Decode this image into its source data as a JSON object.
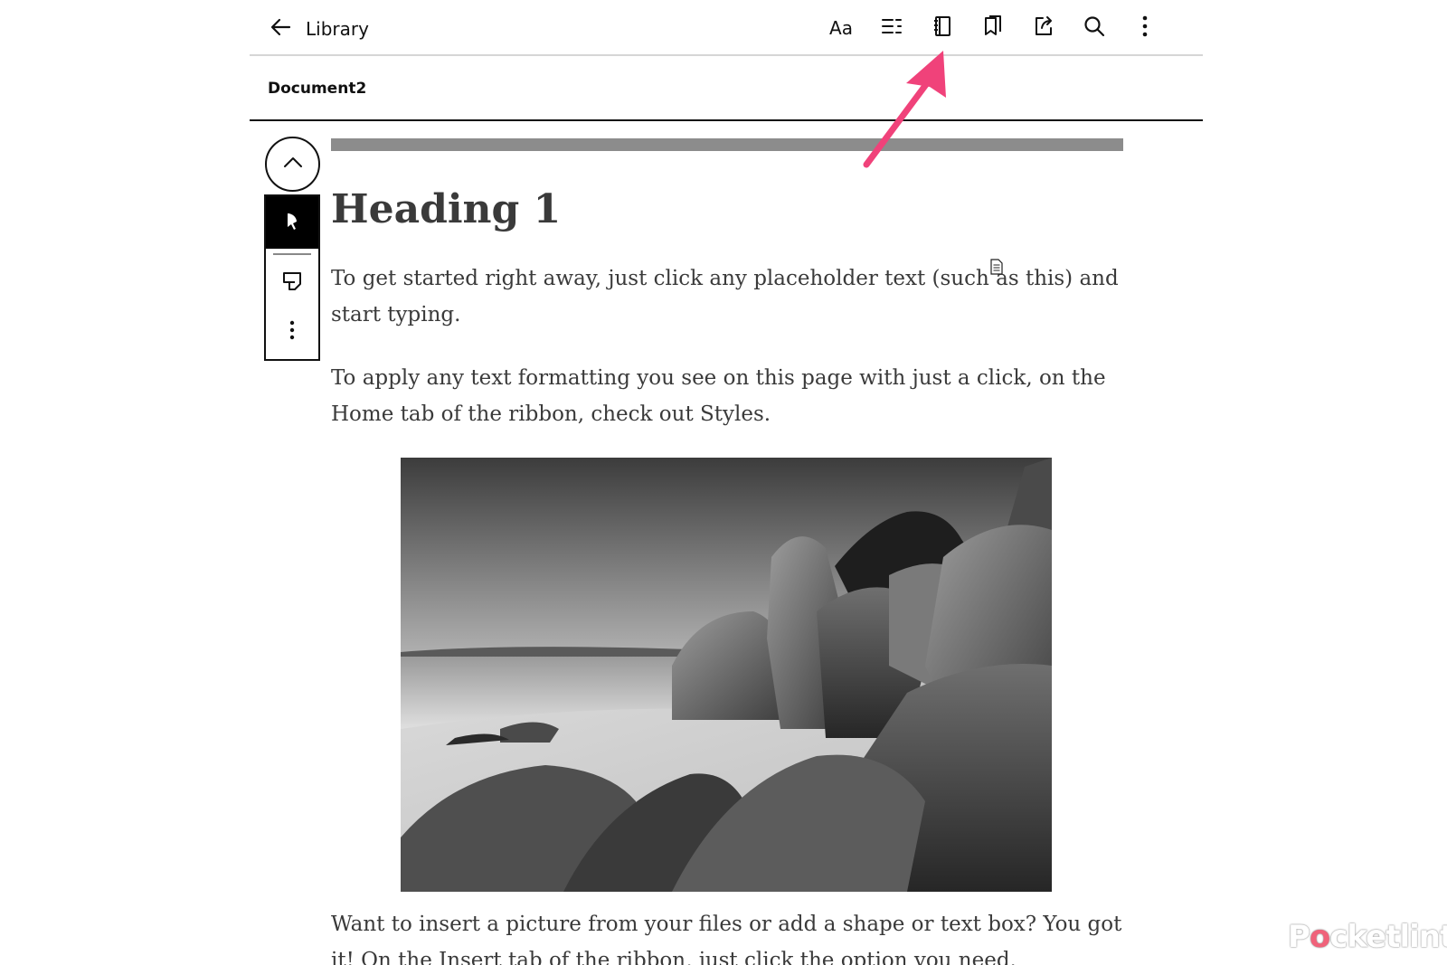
{
  "toolbar": {
    "back_label": "Library",
    "font_label": "Aa",
    "icons": [
      "back-arrow-icon",
      "contents-icon",
      "notebook-icon",
      "bookmarks-icon",
      "share-icon",
      "search-icon",
      "more-vertical-icon"
    ]
  },
  "document": {
    "title": "Document2",
    "heading": "Heading 1",
    "paragraphs": [
      "To get started right away, just click any placeholder text (such as this) and start typing.",
      "To apply any text formatting you see on this page with just a click, on the Home tab of the ribbon, check out Styles.",
      "Want to insert a picture from your files or add a shape or text box? You got it! On the Insert tab of the ribbon, just click the option you need."
    ]
  },
  "side_panel": {
    "icons": [
      "chevron-up-icon",
      "pen-icon",
      "sticky-note-icon",
      "more-vertical-icon"
    ]
  },
  "colors": {
    "annotation_arrow": "#f0427a",
    "text": "#3a3a3a",
    "progress": "#8c8c8c"
  },
  "watermark": {
    "text": "Pocketlint"
  }
}
